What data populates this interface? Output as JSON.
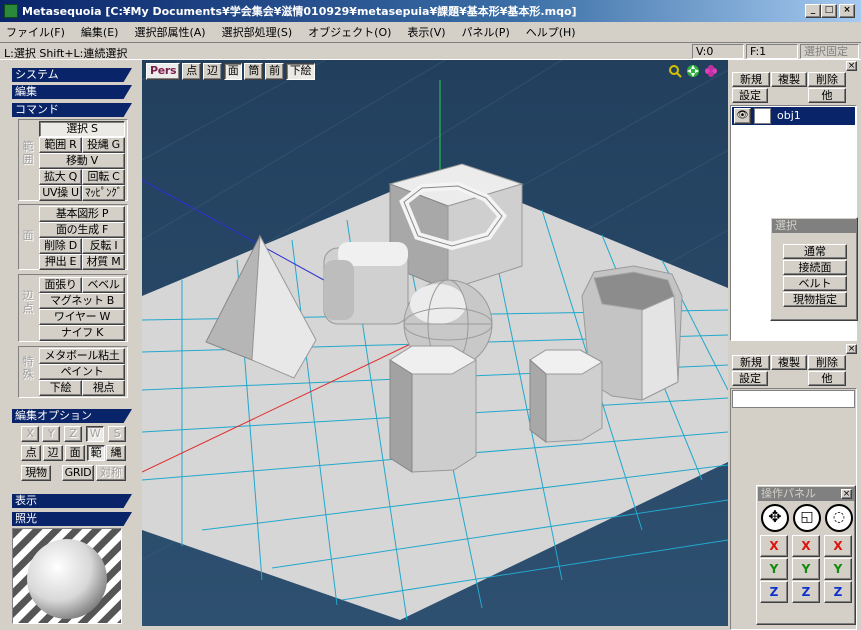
{
  "window": {
    "title": "Metasequoia [C:¥My Documents¥学会集会¥滋情010929¥metasepuia¥課題¥基本形¥基本形.mqo]",
    "min": "_",
    "max": "□",
    "close": "×"
  },
  "menu": [
    "ファイル(F)",
    "編集(E)",
    "選択部属性(A)",
    "選択部処理(S)",
    "オブジェクト(O)",
    "表示(V)",
    "パネル(P)",
    "ヘルプ(H)"
  ],
  "status": {
    "hint": "L:選択 Shift+L:連続選択",
    "v": "V:0",
    "f": "F:1",
    "lock": "選択固定"
  },
  "left": {
    "h_system": "システム",
    "h_edit": "編集",
    "h_command": "コマンド",
    "g1_label": "範囲",
    "g1": [
      "選択 S",
      "範囲 R",
      "投縄 G",
      "移動 V",
      "拡大 Q",
      "回転 C",
      "UV操 U",
      "ﾏｯﾋﾟﾝｸﾞ"
    ],
    "g2_label": "面",
    "g2": [
      "基本図形 P",
      "面の生成 F",
      "削除 D",
      "反転 I",
      "押出 E",
      "材質 M"
    ],
    "g3_label": "辺点",
    "g3": [
      "面張り",
      "ベベル",
      "マグネット B",
      "ワイヤー W",
      "ナイフ K"
    ],
    "g4_label": "特殊",
    "g4": [
      "メタボール粘土",
      "ペイント",
      "下絵",
      "視点"
    ],
    "h_options": "編集オプション",
    "opt1": [
      "X",
      "Y",
      "Z",
      "W",
      "S"
    ],
    "opt2": [
      "点",
      "辺",
      "面",
      "範",
      "縄"
    ],
    "opt3": [
      "現物",
      "GRID",
      "対称"
    ],
    "h_display": "表示",
    "h_light": "照光"
  },
  "viewport": {
    "tools": [
      "Pers",
      "点",
      "辺",
      "面",
      "筒",
      "前",
      "下絵"
    ]
  },
  "objpanel": {
    "new": "新規",
    "dup": "複製",
    "del": "削除",
    "settings": "設定",
    "other": "他",
    "object": "obj1"
  },
  "selectpanel": {
    "title": "選択",
    "opts": [
      "通常",
      "接続面",
      "ベルト",
      "現物指定"
    ]
  },
  "matpanel": {
    "new": "新規",
    "dup": "複製",
    "del": "削除",
    "settings": "設定",
    "other": "他"
  },
  "oppanel": {
    "title": "操作パネル",
    "x": "X",
    "y": "Y",
    "z": "Z"
  },
  "colors": {
    "titlebar": "#0a246a",
    "header": "#0a246a",
    "viewport": "#2c4a68",
    "grid": "#25a0c4"
  }
}
